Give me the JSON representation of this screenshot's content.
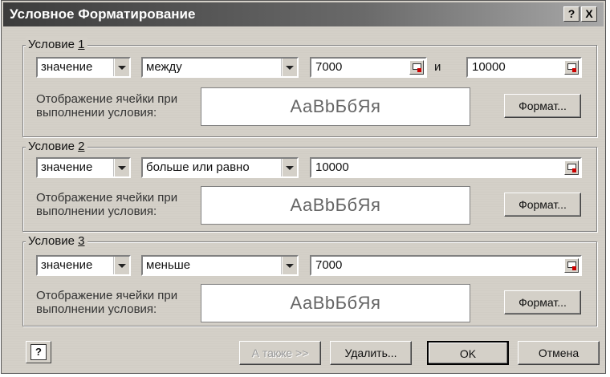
{
  "dialog": {
    "title": "Условное Форматирование",
    "help_glyph": "?",
    "close_glyph": "X"
  },
  "conditions": [
    {
      "legend_prefix": "Условие ",
      "legend_number": "1",
      "type": "значение",
      "operator": "между",
      "value1": "7000",
      "and_label": "и",
      "value2": "10000",
      "format_label_line1": "Отображение ячейки при",
      "format_label_line2": "выполнении условия:",
      "preview_text": "АаBbБбЯя",
      "format_button": "Формат..."
    },
    {
      "legend_prefix": "Условие ",
      "legend_number": "2",
      "type": "значение",
      "operator": "больше или равно",
      "value1": "10000",
      "format_label_line1": "Отображение ячейки при",
      "format_label_line2": "выполнении условия:",
      "preview_text": "АаBbБбЯя",
      "format_button": "Формат..."
    },
    {
      "legend_prefix": "Условие ",
      "legend_number": "3",
      "type": "значение",
      "operator": "меньше",
      "value1": "7000",
      "format_label_line1": "Отображение ячейки при",
      "format_label_line2": "выполнении условия:",
      "preview_text": "АаBbБбЯя",
      "format_button": "Формат..."
    }
  ],
  "footer": {
    "help_glyph": "?",
    "also_button": "А также >>",
    "delete_button": "Удалить...",
    "ok_button": "OK",
    "cancel_button": "Отмена"
  }
}
